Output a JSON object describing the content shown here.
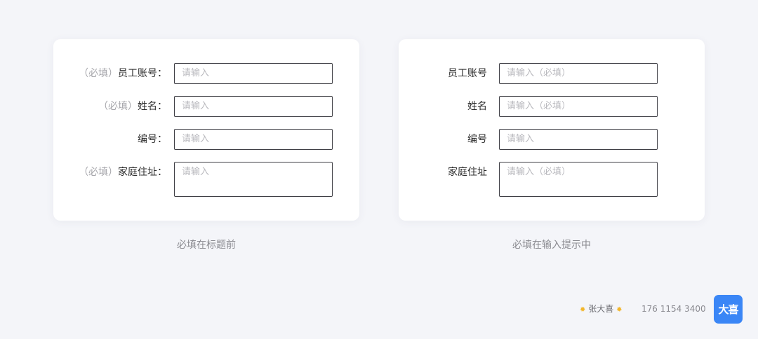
{
  "left_form": {
    "rows": [
      {
        "required": "（必填）",
        "label": "员工账号：",
        "placeholder": "请输入",
        "type": "input"
      },
      {
        "required": "（必填）",
        "label": "姓名：",
        "placeholder": "请输入",
        "type": "input"
      },
      {
        "required": "",
        "label": "编号：",
        "placeholder": "请输入",
        "type": "input"
      },
      {
        "required": "（必填）",
        "label": "家庭住址：",
        "placeholder": "请输入",
        "type": "textarea"
      }
    ],
    "caption": "必填在标题前"
  },
  "right_form": {
    "rows": [
      {
        "label": "员工账号",
        "placeholder": "请输入（必填）",
        "type": "input"
      },
      {
        "label": "姓名",
        "placeholder": "请输入（必填）",
        "type": "input"
      },
      {
        "label": "编号",
        "placeholder": "请输入",
        "type": "input"
      },
      {
        "label": "家庭住址",
        "placeholder": "请输入（必填）",
        "type": "textarea"
      }
    ],
    "caption": "必填在输入提示中"
  },
  "footer": {
    "author": "张大喜",
    "phone": "176 1154 3400",
    "logo_text": "大喜",
    "logo_color": "#3a86f6",
    "sun_icon": "sun-icon"
  }
}
